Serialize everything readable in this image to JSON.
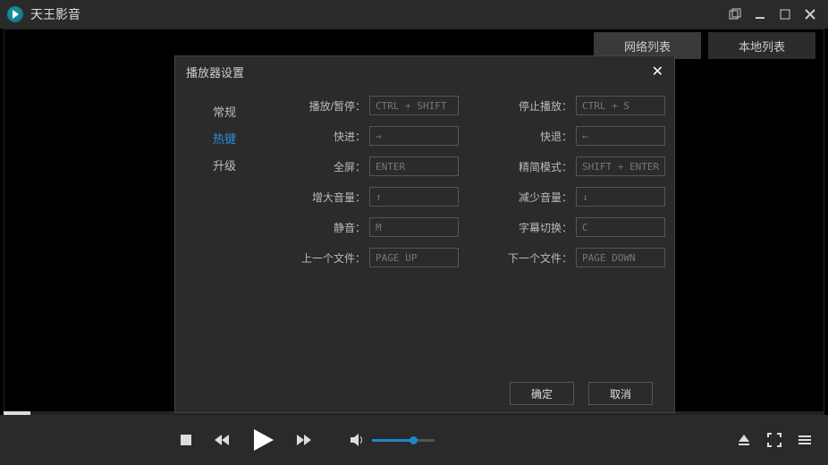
{
  "app": {
    "title": "天王影音"
  },
  "mainTabs": {
    "network": "网络列表",
    "local": "本地列表"
  },
  "dialog": {
    "title": "播放器设置",
    "sidebar": {
      "general": "常规",
      "hotkey": "热键",
      "upgrade": "升级"
    },
    "hotkeys": {
      "left": [
        {
          "label": "播放/暂停：",
          "value": "CTRL + SHIFT +"
        },
        {
          "label": "快进：",
          "value": "→"
        },
        {
          "label": "全屏：",
          "value": "ENTER"
        },
        {
          "label": "增大音量：",
          "value": "↑"
        },
        {
          "label": "静音：",
          "value": "M"
        },
        {
          "label": "上一个文件：",
          "value": "PAGE UP"
        }
      ],
      "right": [
        {
          "label": "停止播放：",
          "value": "CTRL + S"
        },
        {
          "label": "快退：",
          "value": "←"
        },
        {
          "label": "精简模式：",
          "value": "SHIFT + ENTER"
        },
        {
          "label": "减少音量：",
          "value": "↓"
        },
        {
          "label": "字幕切换：",
          "value": "C"
        },
        {
          "label": "下一个文件：",
          "value": "PAGE DOWN"
        }
      ]
    },
    "buttons": {
      "ok": "确定",
      "cancel": "取消"
    }
  }
}
